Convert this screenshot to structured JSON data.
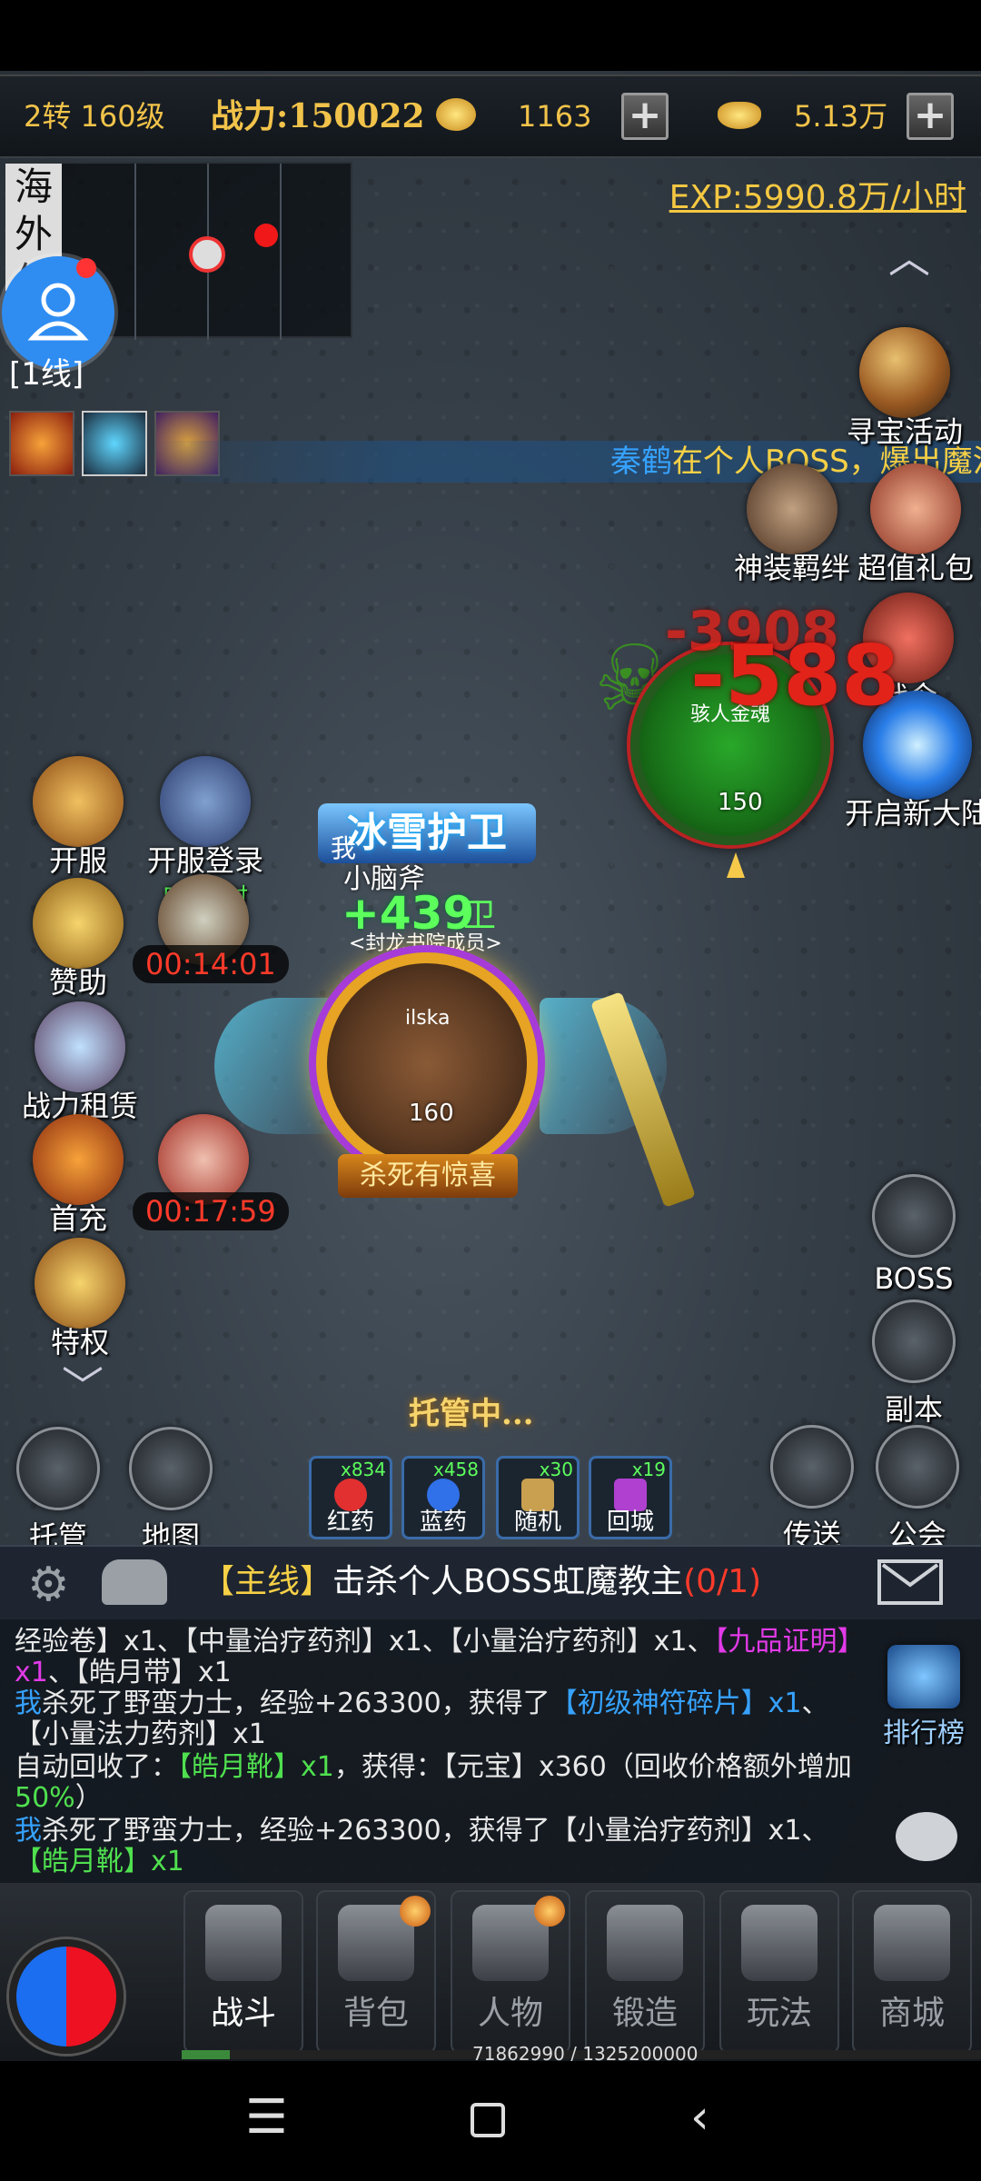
{
  "topbar": {
    "level": "2转 160级",
    "power": "战力:150022",
    "coins": "1163",
    "ingots": "5.13万",
    "plus_symbol": "+"
  },
  "minimap": {
    "server_label": "海外仙",
    "line_label": "[1线]"
  },
  "exp_rate": "EXP:5990.8万/小时",
  "banner": {
    "player": "秦鹤",
    "text": "在个人BOSS，爆出魔法"
  },
  "right_icons": {
    "treasure": "寻宝活动",
    "bond": "神装羁绊",
    "gift": "超值礼包",
    "battle_order": "战令",
    "new_land": "开启新大陆",
    "boss": "BOSS",
    "dungeon": "副本",
    "teleport": "传送",
    "guild": "公会",
    "ranking": "排行榜"
  },
  "left_icons": {
    "open_server": "开服",
    "open_login": "开服登录",
    "open_login_sub": "5天08时",
    "sponsor": "赞助",
    "sponsor_timer": "00:14:01",
    "rent": "战力租赁",
    "first_charge": "首充",
    "first_charge_timer": "00:17:59",
    "privilege": "特权",
    "auto": "托管",
    "map": "地图"
  },
  "monster": {
    "name": "骇人金魂",
    "level": "150",
    "damage1": "-3908",
    "damage2": "-588"
  },
  "player": {
    "title": "冰雪护卫",
    "prefix": "我",
    "name": "小脑斧",
    "heal": "+439",
    "guild": "<封龙书院成员>",
    "avatar_name": "ilska",
    "level": "160",
    "surprise": "杀死有惊喜",
    "guard_suffix": "卫"
  },
  "auto_status": "托管中...",
  "potions": [
    {
      "label": "红药",
      "count": "x834",
      "color": "#e23030"
    },
    {
      "label": "蓝药",
      "count": "x458",
      "color": "#3070e8"
    },
    {
      "label": "随机",
      "count": "x30",
      "color": "#c8a050"
    },
    {
      "label": "回城",
      "count": "x19",
      "color": "#b040d0"
    }
  ],
  "quest": {
    "tag": "【主线】",
    "text": "击杀个人BOSS虹魔教主",
    "progress": "(0/1)"
  },
  "chat": {
    "line1_a": "经验卷】x1、【中量治疗药剂】x1、【小量治疗药剂】x1、",
    "line1_b": "【九品证明】x1",
    "line1_c": "、【皓月带】x1",
    "line2_me": "我",
    "line2_a": "杀死了野蛮力士，经验+263300，获得了",
    "line2_b": "【初级神符碎片】x1",
    "line2_c": "、【小量法力药剂】x1",
    "line3_a": "自动回收了：",
    "line3_b": "【皓月靴】x1",
    "line3_c": "，获得：【元宝】x360（回收价格额外增加",
    "line3_d": "50%",
    "line3_e": "）",
    "line4_me": "我",
    "line4_a": "杀死了野蛮力士，经验+263300，获得了【小量治疗药剂】x1、",
    "line4_b": "【皓月靴】x1"
  },
  "nav": [
    {
      "label": "战斗",
      "active": true
    },
    {
      "label": "背包",
      "badge": true
    },
    {
      "label": "人物",
      "badge": true
    },
    {
      "label": "锻造"
    },
    {
      "label": "玩法"
    },
    {
      "label": "商城"
    }
  ],
  "exp_bar": "71862990 / 1325200000",
  "colors": {
    "accent": "#f2c34a",
    "danger": "#e2231a",
    "heal": "#5cff5c",
    "link": "#36a2ff",
    "rare": "#e23ae8"
  }
}
